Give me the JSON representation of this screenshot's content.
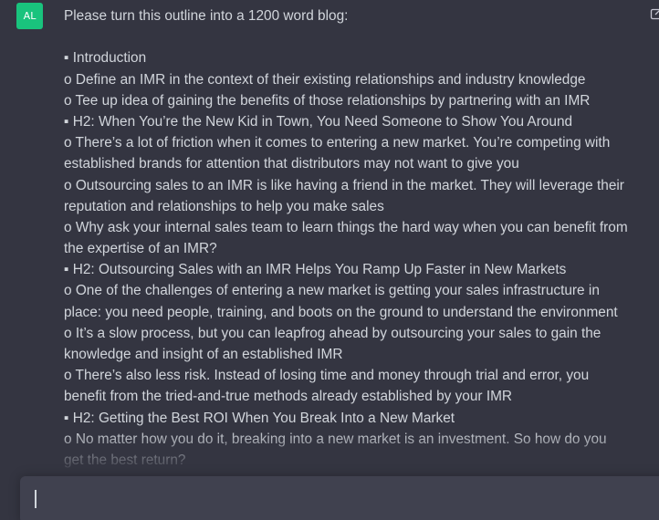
{
  "colors": {
    "background": "#343541",
    "text": "#d1d5db",
    "avatar_bg": "#19c37d",
    "composer_bg": "#40414f"
  },
  "message": {
    "avatar_initials": "AL",
    "lines": [
      "Please turn this outline into a 1200 word blog:",
      "",
      "▪ Introduction",
      "o Define an IMR in the context of their existing relationships and industry knowledge",
      "o Tee up idea of gaining the benefits of those relationships by partnering with an IMR",
      "▪ H2: When You’re the New Kid in Town, You Need Someone to Show You Around",
      "o There’s a lot of friction when it comes to entering a new market. You’re competing with",
      "established brands for attention that distributors may not want to give you",
      "o Outsourcing sales to an IMR is like having a friend in the market. They will leverage their",
      "reputation and relationships to help you make sales",
      "o Why ask your internal sales team to learn things the hard way when you can benefit from",
      "the expertise of an IMR?",
      "▪ H2: Outsourcing Sales with an IMR Helps You Ramp Up Faster in New Markets",
      "o One of the challenges of entering a new market is getting your sales infrastructure in",
      "place: you need people, training, and boots on the ground to understand the environment",
      "o It’s a slow process, but you can leapfrog ahead by outsourcing your sales to gain the",
      "knowledge and insight of an established IMR",
      "o There’s also less risk. Instead of losing time and money through trial and error, you",
      "benefit from the tried-and-true methods already established by your IMR",
      "▪ H2: Getting the Best ROI When You Break Into a New Market",
      "o No matter how you do it, breaking into a new market is an investment. So how do you",
      "get the best return?"
    ]
  },
  "composer": {
    "value": ""
  }
}
